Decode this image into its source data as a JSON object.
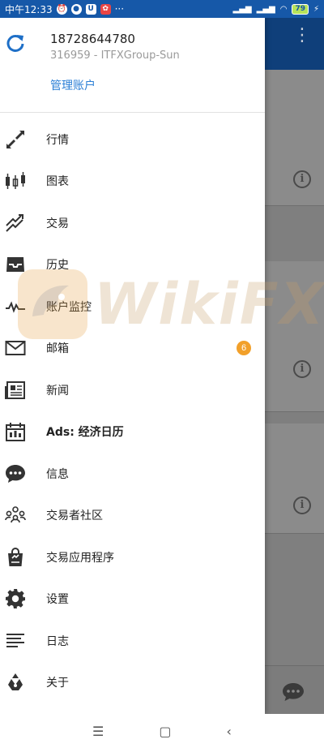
{
  "status_bar": {
    "time": "中午12:33",
    "dots": "···",
    "battery": "79"
  },
  "account": {
    "number": "18728644780",
    "server": "316959 - ITFXGroup-Sun",
    "manage_label": "管理账户"
  },
  "menu": [
    {
      "label": "行情",
      "icon": "quotes-icon"
    },
    {
      "label": "图表",
      "icon": "candlestick-chart-icon"
    },
    {
      "label": "交易",
      "icon": "trade-icon"
    },
    {
      "label": "历史",
      "icon": "history-inbox-icon"
    },
    {
      "label": "账户监控",
      "icon": "account-monitor-icon"
    },
    {
      "label": "邮箱",
      "icon": "mail-icon",
      "badge": "6"
    },
    {
      "label": "新闻",
      "icon": "news-icon"
    },
    {
      "label": "Ads: 经济日历",
      "icon": "calendar-icon"
    },
    {
      "label": "信息",
      "icon": "message-icon"
    },
    {
      "label": "交易者社区",
      "icon": "community-icon"
    },
    {
      "label": "交易应用程序",
      "icon": "app-store-icon"
    },
    {
      "label": "设置",
      "icon": "gear-icon"
    },
    {
      "label": "日志",
      "icon": "journal-icon"
    },
    {
      "label": "关于",
      "icon": "about-icon"
    }
  ],
  "watermark": "WikiFX",
  "colors": {
    "accent": "#2c7fd6",
    "badge": "#f2a02a",
    "statusbar": "#1658a8",
    "appbar": "#0f3f7a"
  }
}
